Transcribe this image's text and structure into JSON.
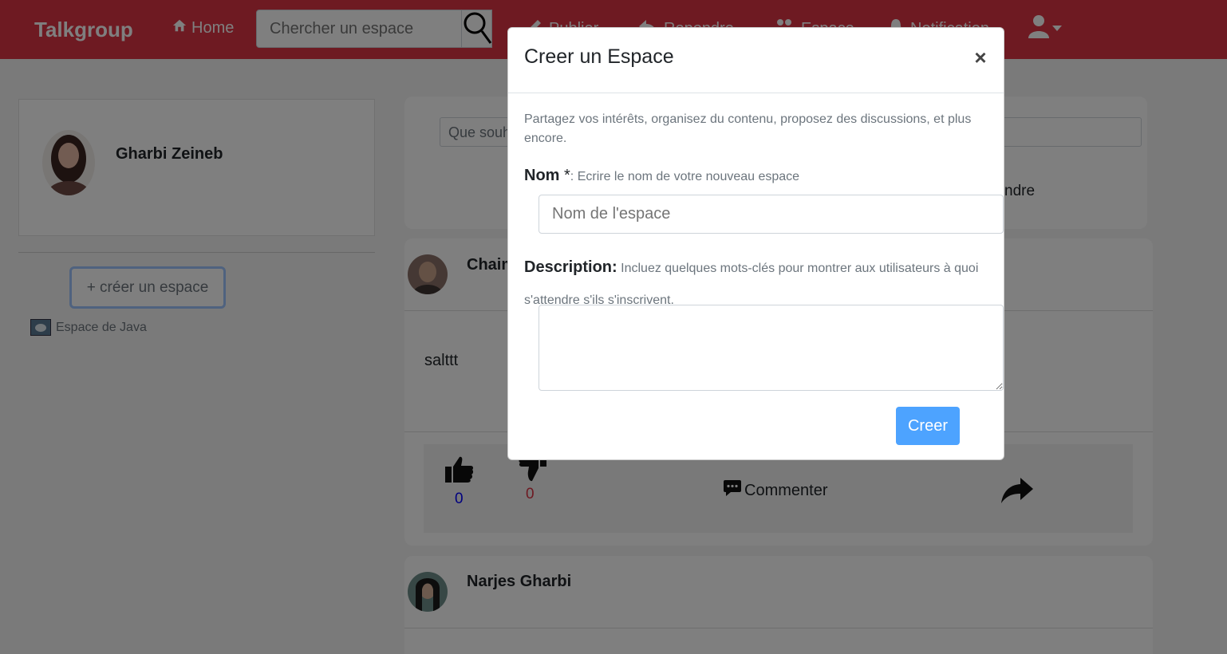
{
  "navbar": {
    "brand": "Talkgroup",
    "home_label": "Home",
    "search_placeholder": "Chercher un espace",
    "publish_label": "Publier",
    "reply_label": "Repondre",
    "space_label": "Espace",
    "notification_label": "Notification",
    "color": "#dc3545"
  },
  "profile": {
    "name": "Gharbi Zeineb"
  },
  "sidebar": {
    "create_space_label": "+ créer un espace",
    "spaces": [
      {
        "label": "Espace de Java"
      }
    ]
  },
  "ask": {
    "placeholder_visible": "Que souh",
    "action_visible": "ndre"
  },
  "posts": [
    {
      "author_visible": "Chaim",
      "body": "salttt",
      "likes": "0",
      "dislikes": "0",
      "comment_label": "Commenter"
    },
    {
      "author_visible": "Narjes Gharbi"
    }
  ],
  "modal": {
    "title": "Creer un Espace",
    "close_symbol": "×",
    "intro": "Partagez vos intérêts, organisez du contenu, proposez des discussions, et plus encore.",
    "name_label": "Nom",
    "name_required": " *",
    "name_hint": ": Ecrire le nom de votre nouveau espace",
    "name_placeholder": "Nom de l'espace",
    "description_label": "Description:",
    "description_hint": "Incluez quelques mots-clés pour montrer aux utilisateurs à quoi s'attendre s'ils s'inscrivent.",
    "submit_label": "Creer",
    "submit_color": "#4da3ff"
  }
}
